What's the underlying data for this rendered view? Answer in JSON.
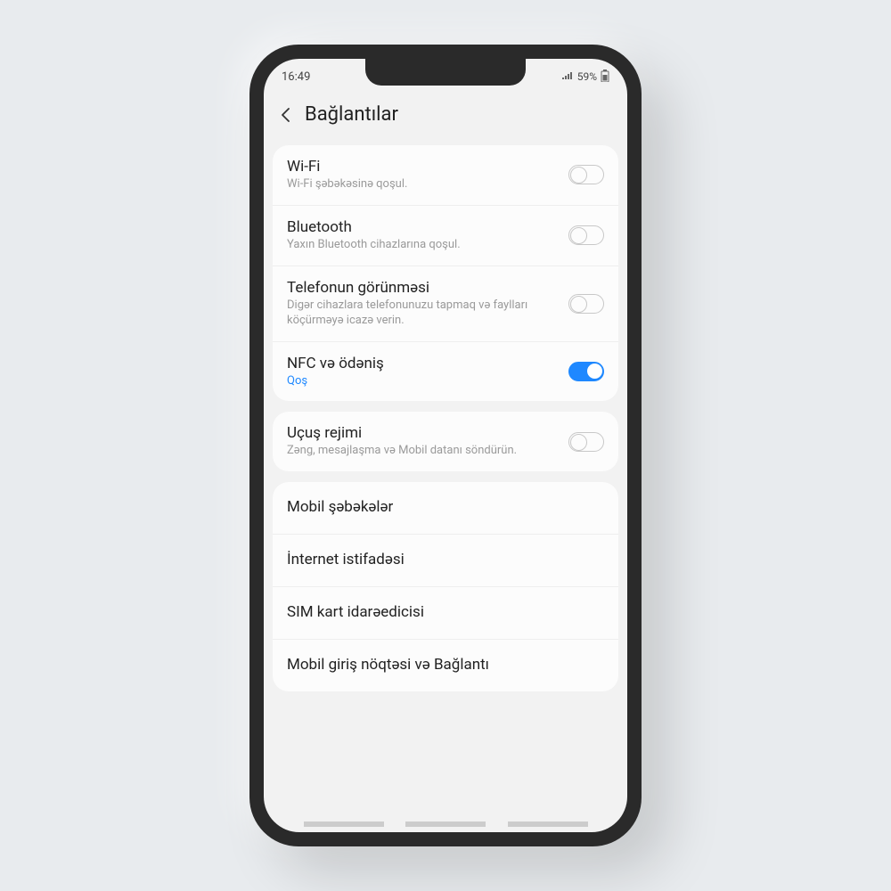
{
  "status": {
    "time": "16:49",
    "battery_text": "59%"
  },
  "header": {
    "title": "Bağlantılar"
  },
  "group1": {
    "wifi": {
      "title": "Wi-Fi",
      "sub": "Wi-Fi şəbəkəsinə qoşul.",
      "on": false
    },
    "bluetooth": {
      "title": "Bluetooth",
      "sub": "Yaxın Bluetooth cihazlarına qoşul.",
      "on": false
    },
    "visibility": {
      "title": "Telefonun görünməsi",
      "sub": "Digər cihazlara telefonunuzu tapmaq və faylları köçürməyə icazə verin.",
      "on": false
    },
    "nfc": {
      "title": "NFC və ödəniş",
      "sub": "Qoş",
      "on": true
    }
  },
  "group2": {
    "flight": {
      "title": "Uçuş rejimi",
      "sub": "Zəng, mesajlaşma və Mobil datanı söndürün.",
      "on": false
    }
  },
  "group3": {
    "mobile_networks": "Mobil şəbəkələr",
    "data_usage": "İnternet istifadəsi",
    "sim_manager": "SIM kart idarəedicisi",
    "hotspot": "Mobil giriş nöqtəsi və Bağlantı"
  },
  "colors": {
    "accent": "#1e88ff"
  }
}
